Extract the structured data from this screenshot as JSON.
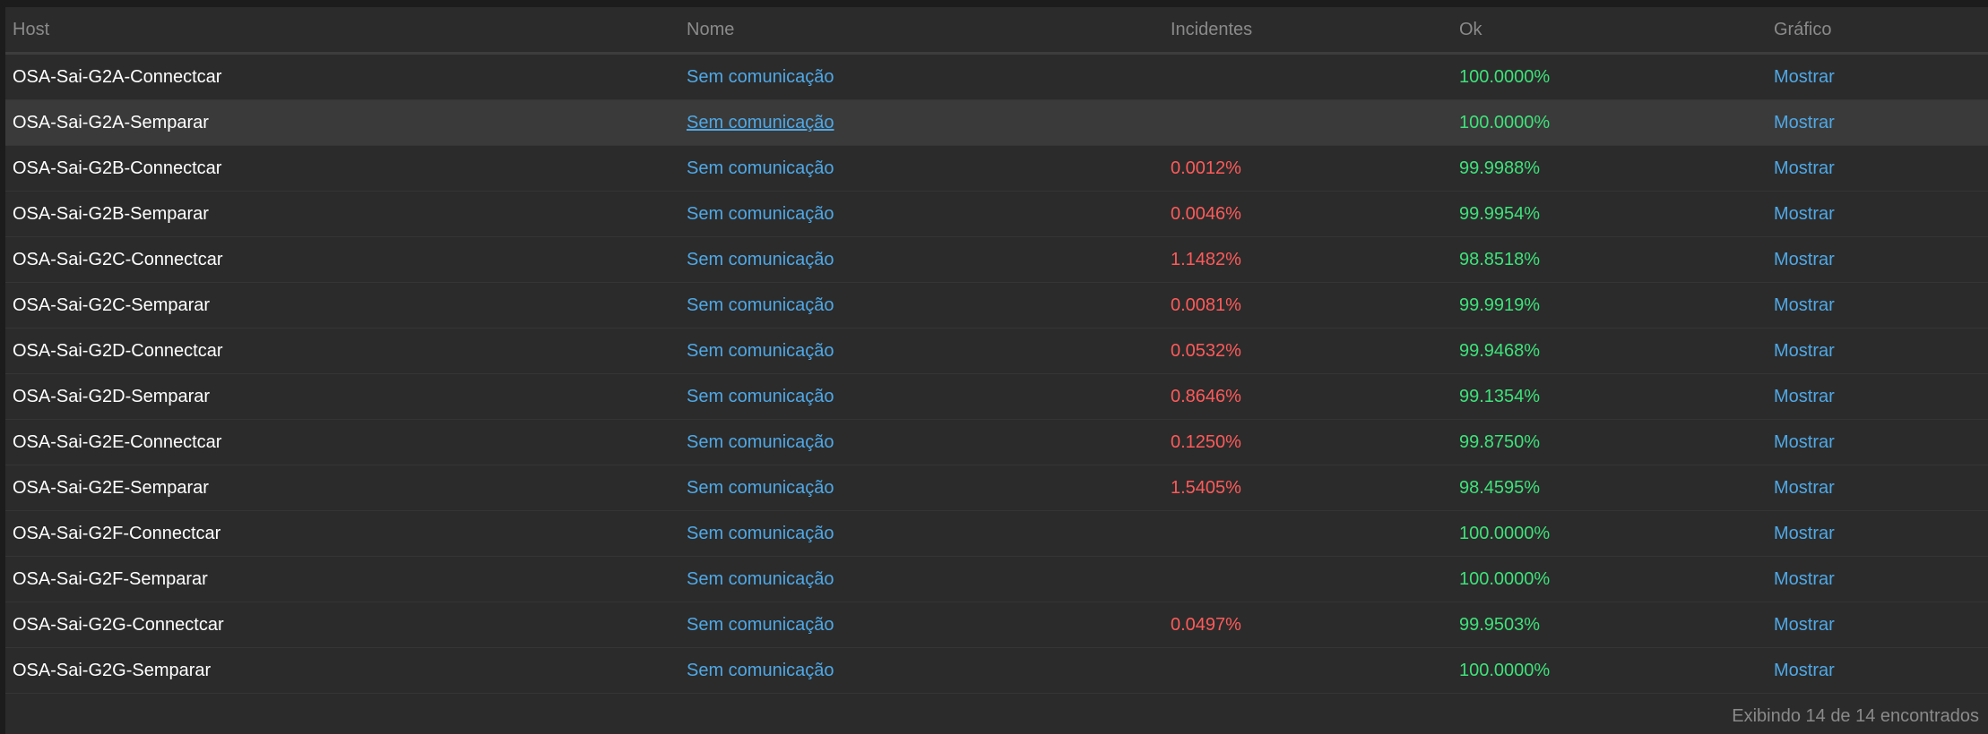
{
  "table": {
    "columns": [
      "Host",
      "Nome",
      "Incidentes",
      "Ok",
      "Gráfico"
    ],
    "rows": [
      {
        "host": "OSA-Sai-G2A-Connectcar",
        "nome": "Sem comunicação",
        "incidentes": "",
        "ok": "100.0000%",
        "grafico": "Mostrar"
      },
      {
        "host": "OSA-Sai-G2A-Semparar",
        "nome": "Sem comunicação",
        "incidentes": "",
        "ok": "100.0000%",
        "grafico": "Mostrar"
      },
      {
        "host": "OSA-Sai-G2B-Connectcar",
        "nome": "Sem comunicação",
        "incidentes": "0.0012%",
        "ok": "99.9988%",
        "grafico": "Mostrar"
      },
      {
        "host": "OSA-Sai-G2B-Semparar",
        "nome": "Sem comunicação",
        "incidentes": "0.0046%",
        "ok": "99.9954%",
        "grafico": "Mostrar"
      },
      {
        "host": "OSA-Sai-G2C-Connectcar",
        "nome": "Sem comunicação",
        "incidentes": "1.1482%",
        "ok": "98.8518%",
        "grafico": "Mostrar"
      },
      {
        "host": "OSA-Sai-G2C-Semparar",
        "nome": "Sem comunicação",
        "incidentes": "0.0081%",
        "ok": "99.9919%",
        "grafico": "Mostrar"
      },
      {
        "host": "OSA-Sai-G2D-Connectcar",
        "nome": "Sem comunicação",
        "incidentes": "0.0532%",
        "ok": "99.9468%",
        "grafico": "Mostrar"
      },
      {
        "host": "OSA-Sai-G2D-Semparar",
        "nome": "Sem comunicação",
        "incidentes": "0.8646%",
        "ok": "99.1354%",
        "grafico": "Mostrar"
      },
      {
        "host": "OSA-Sai-G2E-Connectcar",
        "nome": "Sem comunicação",
        "incidentes": "0.1250%",
        "ok": "99.8750%",
        "grafico": "Mostrar"
      },
      {
        "host": "OSA-Sai-G2E-Semparar",
        "nome": "Sem comunicação",
        "incidentes": "1.5405%",
        "ok": "98.4595%",
        "grafico": "Mostrar"
      },
      {
        "host": "OSA-Sai-G2F-Connectcar",
        "nome": "Sem comunicação",
        "incidentes": "",
        "ok": "100.0000%",
        "grafico": "Mostrar"
      },
      {
        "host": "OSA-Sai-G2F-Semparar",
        "nome": "Sem comunicação",
        "incidentes": "",
        "ok": "100.0000%",
        "grafico": "Mostrar"
      },
      {
        "host": "OSA-Sai-G2G-Connectcar",
        "nome": "Sem comunicação",
        "incidentes": "0.0497%",
        "ok": "99.9503%",
        "grafico": "Mostrar"
      },
      {
        "host": "OSA-Sai-G2G-Semparar",
        "nome": "Sem comunicação",
        "incidentes": "",
        "ok": "100.0000%",
        "grafico": "Mostrar"
      }
    ],
    "hovered_row": 1
  },
  "footer": {
    "summary": "Exibindo 14 de 14 encontrados"
  },
  "colors": {
    "background": "#2b2b2b",
    "row_hover": "#3a3a3a",
    "link": "#4fa8e6",
    "incident": "#ff5a5a",
    "ok": "#3ee27a",
    "header_text": "#8a8a8a"
  }
}
